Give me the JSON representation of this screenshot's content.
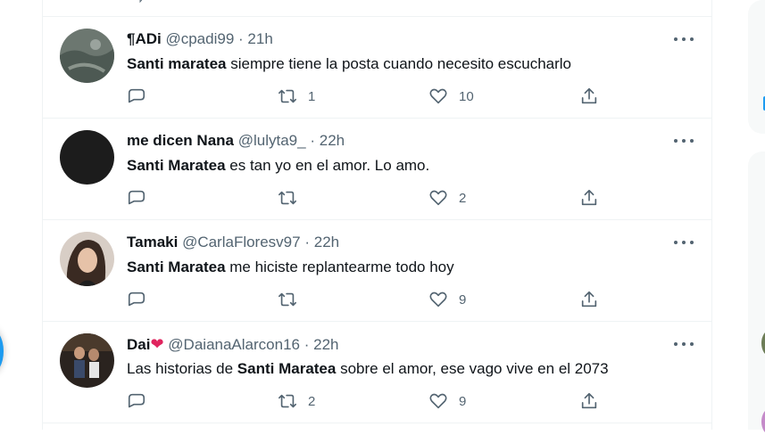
{
  "tweets": [
    {
      "name": "¶ADi",
      "handle": "@cpadi99",
      "time": "21h",
      "mention": "Santi maratea",
      "text_before": "",
      "text_after": " siempre tiene la posta cuando necesito escucharlo",
      "replies": "",
      "retweets": "1",
      "likes": "10",
      "avatar_color": "#5f6b63"
    },
    {
      "name": "me dicen Nana",
      "handle": "@lulyta9_",
      "time": "22h",
      "mention": "Santi Maratea",
      "text_before": "",
      "text_after": " es tan yo en el amor. Lo amo.",
      "replies": "",
      "retweets": "",
      "likes": "2",
      "avatar_color": "#1a1a1a"
    },
    {
      "name": "Tamaki",
      "handle": "@CarlaFloresv97",
      "time": "22h",
      "mention": "Santi Maratea",
      "text_before": "",
      "text_after": " me hiciste replantearme todo hoy",
      "replies": "",
      "retweets": "",
      "likes": "9",
      "avatar_color": "#cbbcb2"
    },
    {
      "name": "Dai",
      "name_emoji": "❤",
      "handle": "@DaianaAlarcon16",
      "time": "22h",
      "mention": "Santi Maratea",
      "text_before": "Las historias de ",
      "text_after": " sobre el amor, ese vago vive en el 2073",
      "replies": "",
      "retweets": "2",
      "likes": "9",
      "avatar_color": "#2b2420"
    }
  ],
  "dot_separator": "·",
  "colors": {
    "accent": "#1d9bf0",
    "muted": "#536471",
    "heart": "#e0245e",
    "border": "#eff3f4"
  },
  "icons": [
    "reply-icon",
    "retweet-icon",
    "like-icon",
    "share-icon",
    "more-icon"
  ]
}
